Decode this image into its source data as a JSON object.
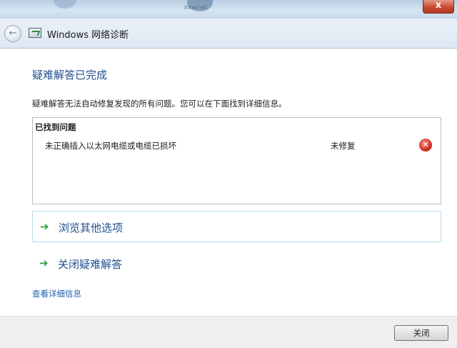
{
  "background_window": {
    "icon_labels": [
      "Internet"
    ],
    "close_label": "x"
  },
  "header": {
    "back_glyph": "←",
    "title": "Windows 网络诊断",
    "icon": "network-diagnostics-icon"
  },
  "main": {
    "title": "疑难解答已完成",
    "description": "疑难解答无法自动修复发现的所有问题。您可以在下面找到详细信息。",
    "problems": {
      "header": "已找到问题",
      "items": [
        {
          "name": "未正确插入以太网电缆或电缆已损坏",
          "status": "未修复",
          "status_icon": "error-icon"
        }
      ]
    },
    "options": [
      {
        "label": "浏览其他选项",
        "icon": "green-arrow-icon"
      },
      {
        "label": "关闭疑难解答",
        "icon": "green-arrow-icon"
      }
    ],
    "details_link": "查看详细信息"
  },
  "footer": {
    "close_button": "关闭"
  },
  "colors": {
    "link": "#1f4e8c",
    "arrow": "#2f9e3c",
    "error": "#c8261a"
  }
}
